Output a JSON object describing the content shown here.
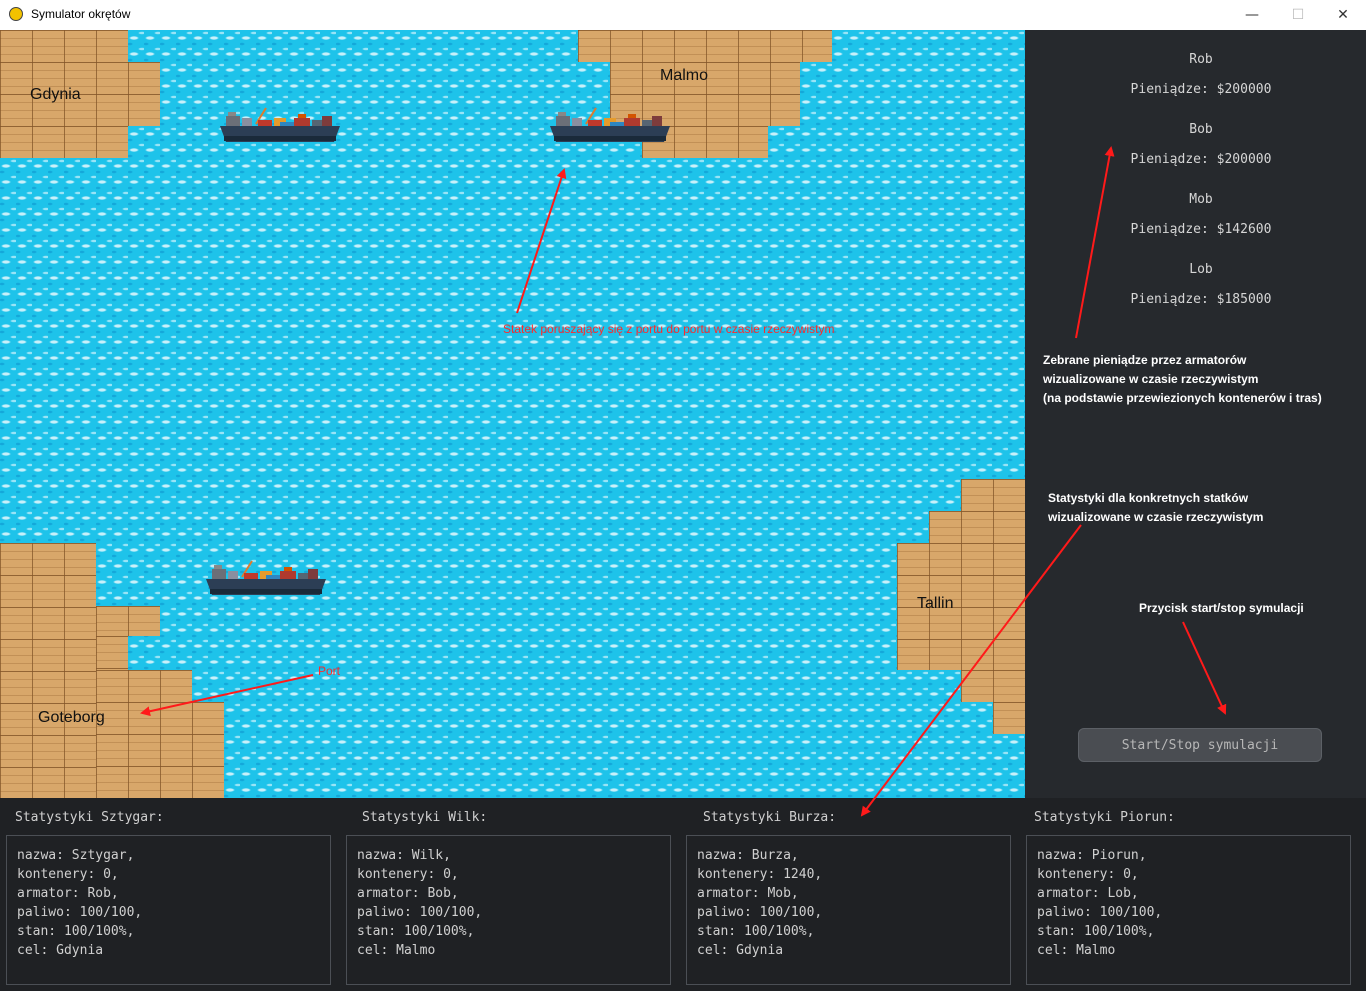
{
  "window": {
    "title": "Symulator okrętów",
    "minimize": "—",
    "maximize": "☐",
    "close": "✕"
  },
  "ports": {
    "gdynia": "Gdynia",
    "malmo": "Malmo",
    "goteborg": "Goteborg",
    "tallin": "Tallin"
  },
  "annotations": {
    "ship": "Statek poruszający się z portu do portu w czasie rzeczywistym",
    "port": "Port"
  },
  "owners": [
    {
      "name": "Rob",
      "money": "Pieniądze: $200000"
    },
    {
      "name": "Bob",
      "money": "Pieniądze: $200000"
    },
    {
      "name": "Mob",
      "money": "Pieniądze: $142600"
    },
    {
      "name": "Lob",
      "money": "Pieniądze: $185000"
    }
  ],
  "side_notes": {
    "money": [
      "Zebrane pieniądze przez armatorów",
      "wizualizowane w czasie rzeczywistym",
      "(na podstawie przewiezionych kontenerów i tras)"
    ],
    "stats": [
      "Statystyki dla konkretnych statków",
      "wizualizowane w czasie rzeczywistym"
    ],
    "button": "Przycisk start/stop symulacji"
  },
  "start_button": "Start/Stop symulacji",
  "stats": [
    {
      "title": "Statystyki Sztygar:",
      "lines": [
        "nazwa: Sztygar,",
        "kontenery: 0,",
        "armator: Rob,",
        "paliwo: 100/100,",
        "stan: 100/100%,",
        "cel: Gdynia"
      ]
    },
    {
      "title": "Statystyki Wilk:",
      "lines": [
        "nazwa: Wilk,",
        "kontenery: 0,",
        "armator: Bob,",
        "paliwo: 100/100,",
        "stan: 100/100%,",
        "cel: Malmo"
      ]
    },
    {
      "title": "Statystyki Burza:",
      "lines": [
        "nazwa: Burza,",
        "kontenery: 1240,",
        "armator: Mob,",
        "paliwo: 100/100,",
        "stan: 100/100%,",
        "cel: Gdynia"
      ]
    },
    {
      "title": "Statystyki Piorun:",
      "lines": [
        "nazwa: Piorun,",
        "kontenery: 0,",
        "armator: Lob,",
        "paliwo: 100/100,",
        "stan: 100/100%,",
        "cel: Malmo"
      ]
    }
  ],
  "colors": {
    "sea": "#1ec3ea",
    "land": "#d8a76a",
    "panel": "#26292d",
    "annotation": "#ff2b2b"
  }
}
